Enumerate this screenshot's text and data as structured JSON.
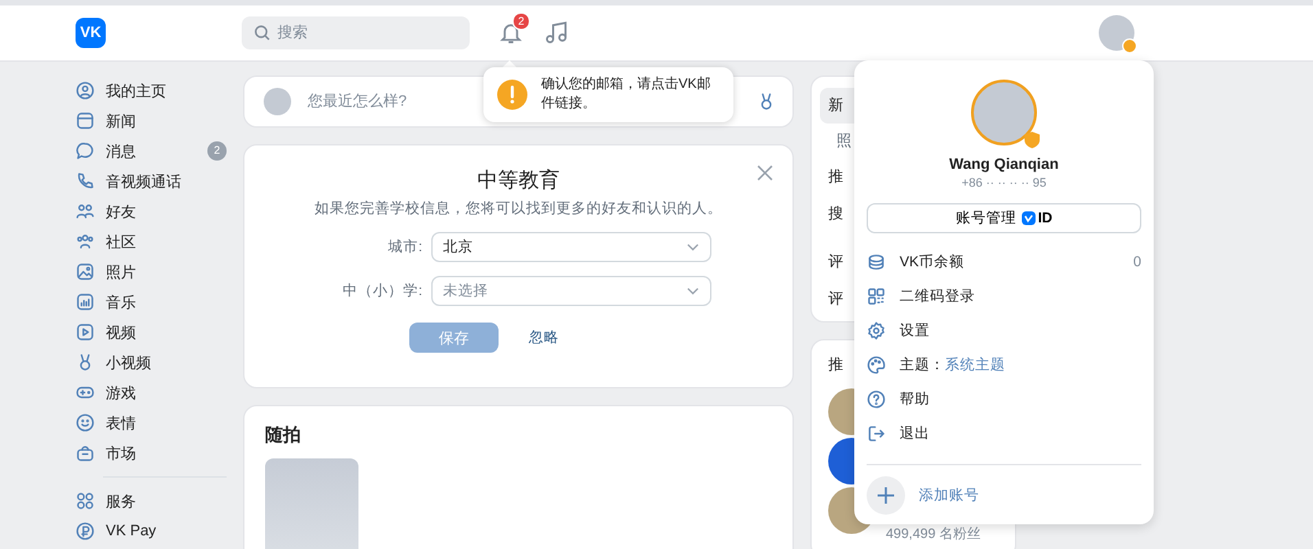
{
  "header": {
    "logo": "VK",
    "search": {
      "placeholder": "搜索"
    },
    "notification_badge": "2"
  },
  "notification_tooltip": {
    "text": "确认您的邮箱，请点击VK邮件链接。"
  },
  "sidebar": {
    "items": [
      {
        "kind": "profile",
        "label": "我的主页"
      },
      {
        "kind": "news",
        "label": "新闻"
      },
      {
        "kind": "messages",
        "label": "消息",
        "badge": "2"
      },
      {
        "kind": "calls",
        "label": "音视频通话"
      },
      {
        "kind": "friends",
        "label": "好友"
      },
      {
        "kind": "communities",
        "label": "社区"
      },
      {
        "kind": "photos",
        "label": "照片"
      },
      {
        "kind": "music",
        "label": "音乐"
      },
      {
        "kind": "video",
        "label": "视频"
      },
      {
        "kind": "clips",
        "label": "小视频"
      },
      {
        "kind": "games",
        "label": "游戏"
      },
      {
        "kind": "stickers",
        "label": "表情"
      },
      {
        "kind": "market",
        "label": "市场"
      }
    ],
    "more_items": [
      {
        "kind": "services",
        "label": "服务"
      },
      {
        "kind": "pay",
        "label": "VK Pay"
      }
    ]
  },
  "composer": {
    "placeholder": "您最近怎么样?"
  },
  "education_card": {
    "title": "中等教育",
    "subtitle": "如果您完善学校信息，您将可以找到更多的好友和认识的人。",
    "fields": [
      {
        "label": "城市:",
        "value": "北京"
      },
      {
        "label": "中（小）学:",
        "placeholder": "未选择"
      }
    ],
    "save_button": {
      "label": "保存",
      "disabled": true
    },
    "skip_link": "忽略"
  },
  "snapshots_card": {
    "title": "随拍"
  },
  "right_panel": {
    "nav_items": [
      {
        "label": "新",
        "selected": true
      },
      {
        "label": "照",
        "selected": false
      }
    ],
    "sections": [
      "推",
      "搜"
    ],
    "reviews": [
      "评",
      "评"
    ],
    "recommendations": {
      "title": "推",
      "communities": [
        {
          "kind": "photo"
        },
        {
          "kind": "logo"
        },
        {
          "kind": "photo",
          "followers": "499,499 名粉丝"
        }
      ]
    }
  },
  "account_menu": {
    "name": "Wang Qianqian",
    "phone": "+86 ·· ·· ·· ·· 95",
    "manage_button": {
      "label": "账号管理",
      "badge": "ID"
    },
    "items": [
      {
        "kind": "coins",
        "label": "VK币余额",
        "value": "0"
      },
      {
        "kind": "qr",
        "label": "二维码登录"
      },
      {
        "kind": "settings",
        "label": "设置"
      },
      {
        "kind": "theme",
        "label": "主题：",
        "value": "系统主题"
      },
      {
        "kind": "help",
        "label": "帮助"
      },
      {
        "kind": "logout",
        "label": "退出"
      }
    ],
    "add_account": "添加账号"
  }
}
